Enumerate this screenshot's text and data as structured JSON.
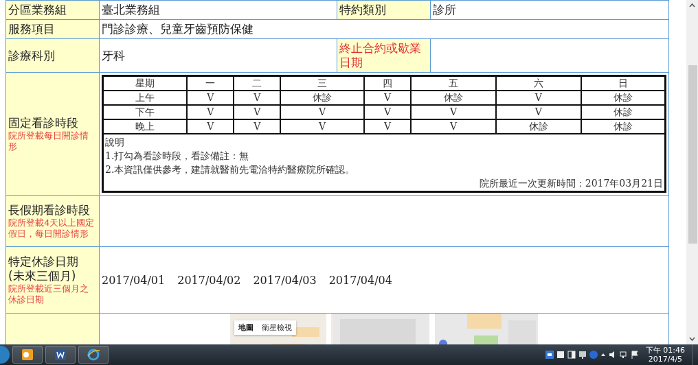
{
  "rows": [
    {
      "kind": "cells",
      "cells": [
        {
          "kind": "label",
          "text": "分區業務組"
        },
        {
          "kind": "value",
          "text": "臺北業務組"
        },
        {
          "kind": "label",
          "text": "特約類別"
        },
        {
          "kind": "value",
          "text": "診所"
        }
      ]
    },
    {
      "kind": "cells",
      "cells": [
        {
          "kind": "label",
          "text": "服務項目"
        },
        {
          "kind": "value",
          "text": "門診診療、兒童牙齒預防保健"
        }
      ]
    },
    {
      "kind": "cells",
      "cells": [
        {
          "kind": "label",
          "text": "診療科別"
        },
        {
          "kind": "value",
          "text": "牙科"
        },
        {
          "kind": "alert_label",
          "text": "終止合約或歇業日期"
        },
        {
          "kind": "value"
        }
      ]
    },
    {
      "kind": "schedule",
      "label": "固定看診時段",
      "note": "院所登載每日開診情形",
      "schedule": {
        "header": [
          "星期",
          "一",
          "二",
          "三",
          "四",
          "五",
          "六",
          "日"
        ],
        "rows": [
          {
            "period": "上午",
            "slots": [
              "V",
              "V",
              "休診",
              "V",
              "休診",
              "V",
              "休診"
            ]
          },
          {
            "period": "下午",
            "slots": [
              "V",
              "V",
              "V",
              "V",
              "V",
              "V",
              "休診"
            ]
          },
          {
            "period": "晚上",
            "slots": [
              "V",
              "V",
              "V",
              "V",
              "V",
              "休診",
              "休診"
            ]
          }
        ],
        "notes": [
          "說明",
          "1.打勾為看診時段，看診備註：無",
          "2.本資訊僅供參考，建請就醫前先電洽特約醫療院所確認。"
        ],
        "updated": "院所最近一次更新時間：2017年03月21日"
      }
    },
    {
      "kind": "blank",
      "label": "長假期看診時段",
      "note": "院所登載4天以上國定假日，每日開診情形"
    },
    {
      "kind": "dates",
      "label": "特定休診日期\n(未來三個月)",
      "note": "院所登載近三個月之休診日期",
      "dates": [
        "2017/04/01",
        "2017/04/02",
        "2017/04/03",
        "2017/04/04"
      ]
    },
    {
      "kind": "map",
      "map_buttons": [
        "地圖",
        "衛星檢視"
      ]
    }
  ],
  "taskbar": {
    "apps": [
      {
        "kind": "outlook"
      },
      {
        "kind": "word"
      },
      {
        "kind": "ie"
      }
    ],
    "time": "下午 01:46",
    "date": "2017/4/5"
  }
}
